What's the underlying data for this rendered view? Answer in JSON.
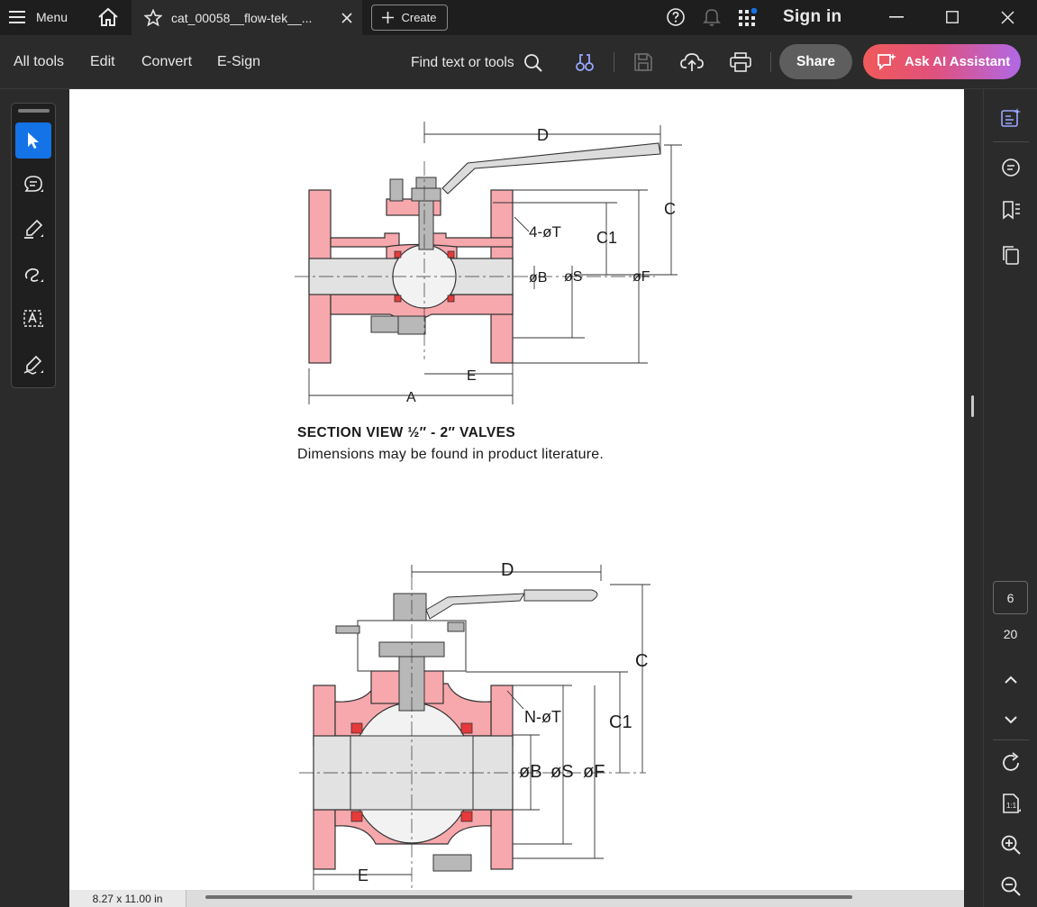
{
  "titlebar": {
    "menu_label": "Menu",
    "tab_title": "cat_00058__flow-tek__...",
    "create_label": "Create",
    "sign_in_label": "Sign in"
  },
  "toolbar": {
    "menus": [
      "All tools",
      "Edit",
      "Convert",
      "E-Sign"
    ],
    "find_label": "Find text or tools",
    "share_label": "Share",
    "ai_label": "Ask AI Assistant"
  },
  "document": {
    "caption_title": "SECTION VIEW ½″ - 2″ VALVES",
    "caption_text": "Dimensions may be found in product literature.",
    "figure1_labels": {
      "D": "D",
      "C": "C",
      "C1": "C1",
      "T": "4-øT",
      "B": "øB",
      "S": "øS",
      "F": "øF",
      "E": "E",
      "A": "A"
    },
    "figure2_labels": {
      "D": "D",
      "C": "C",
      "C1": "C1",
      "T": "N-øT",
      "B": "øB",
      "S": "øS",
      "F": "øF",
      "E": "E"
    }
  },
  "status": {
    "page_size": "8.27 x 11.00 in"
  },
  "navigation": {
    "current_page": "6",
    "total_pages": "20"
  },
  "colors": {
    "accent_blue": "#1473e6",
    "valve_body_pink": "#f7a8ad",
    "seat_red": "#e63a3a",
    "bore_gray": "#e2e2e2",
    "steel_gray": "#b8b8b8"
  }
}
